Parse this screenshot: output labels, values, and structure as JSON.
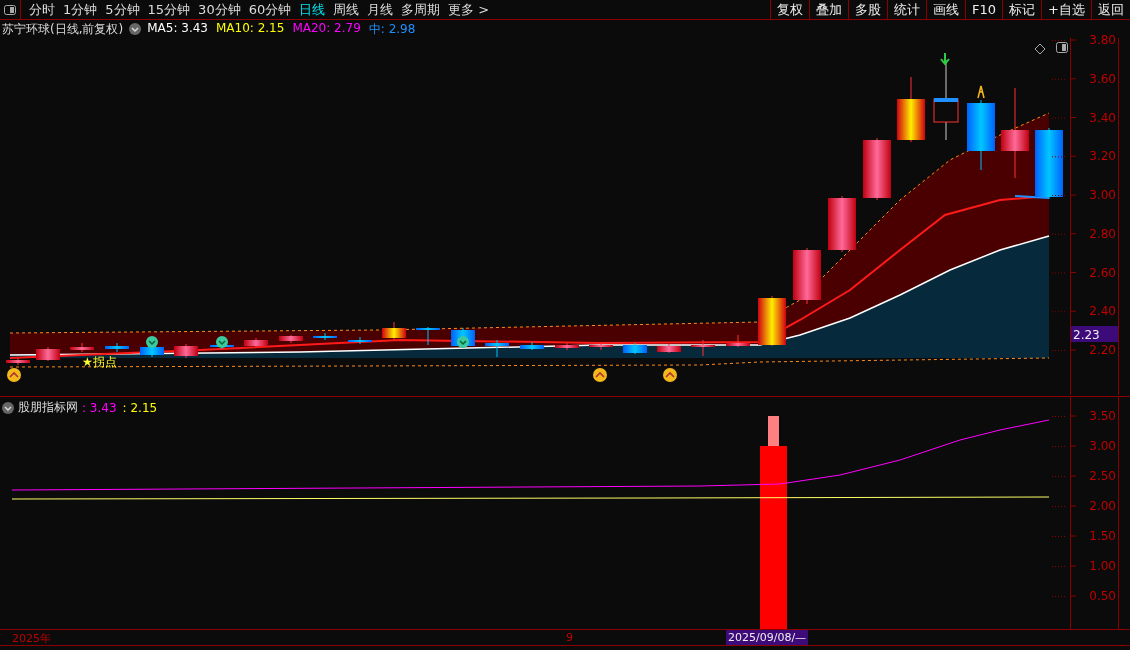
{
  "toolbar": {
    "periods": [
      {
        "label": "分时",
        "selected": false
      },
      {
        "label": "1分钟",
        "selected": false
      },
      {
        "label": "5分钟",
        "selected": false
      },
      {
        "label": "15分钟",
        "selected": false
      },
      {
        "label": "30分钟",
        "selected": false
      },
      {
        "label": "60分钟",
        "selected": false
      },
      {
        "label": "日线",
        "selected": true
      },
      {
        "label": "周线",
        "selected": false
      },
      {
        "label": "月线",
        "selected": false
      },
      {
        "label": "多周期",
        "selected": false
      },
      {
        "label": "更多 >",
        "selected": false
      }
    ],
    "actions": [
      "复权",
      "叠加",
      "多股",
      "统计",
      "画线",
      "F10",
      "标记",
      "+自选",
      "返回"
    ]
  },
  "main_chart": {
    "title": "苏宁环球(日线,前复权)",
    "legend": [
      {
        "label": "MA5: 3.43",
        "color": "#ffffff"
      },
      {
        "label": "MA10: 2.15",
        "color": "#ffff00"
      },
      {
        "label": "MA20: 2.79",
        "color": "#ff00ff"
      },
      {
        "label": "中: 2.98",
        "color": "#1e90ff"
      }
    ],
    "price_axis": [
      "3.80",
      "3.60",
      "3.40",
      "3.20",
      "3.00",
      "2.80",
      "2.60",
      "2.40",
      "2.20"
    ],
    "current_price": "2.23",
    "annotation": "★拐点"
  },
  "indicator_panel": {
    "title": "股朋指标网",
    "values": [
      {
        "text": ": 3.43",
        "color": "#ff00ff"
      },
      {
        "text": ": 2.15",
        "color": "#ffff00"
      }
    ],
    "axis": [
      "3.50",
      "3.00",
      "2.50",
      "2.00",
      "1.50",
      "1.00",
      "0.50"
    ]
  },
  "date_bar": {
    "labels": [
      "2025年",
      "9"
    ],
    "cursor_date": "2025/09/08/—"
  }
}
